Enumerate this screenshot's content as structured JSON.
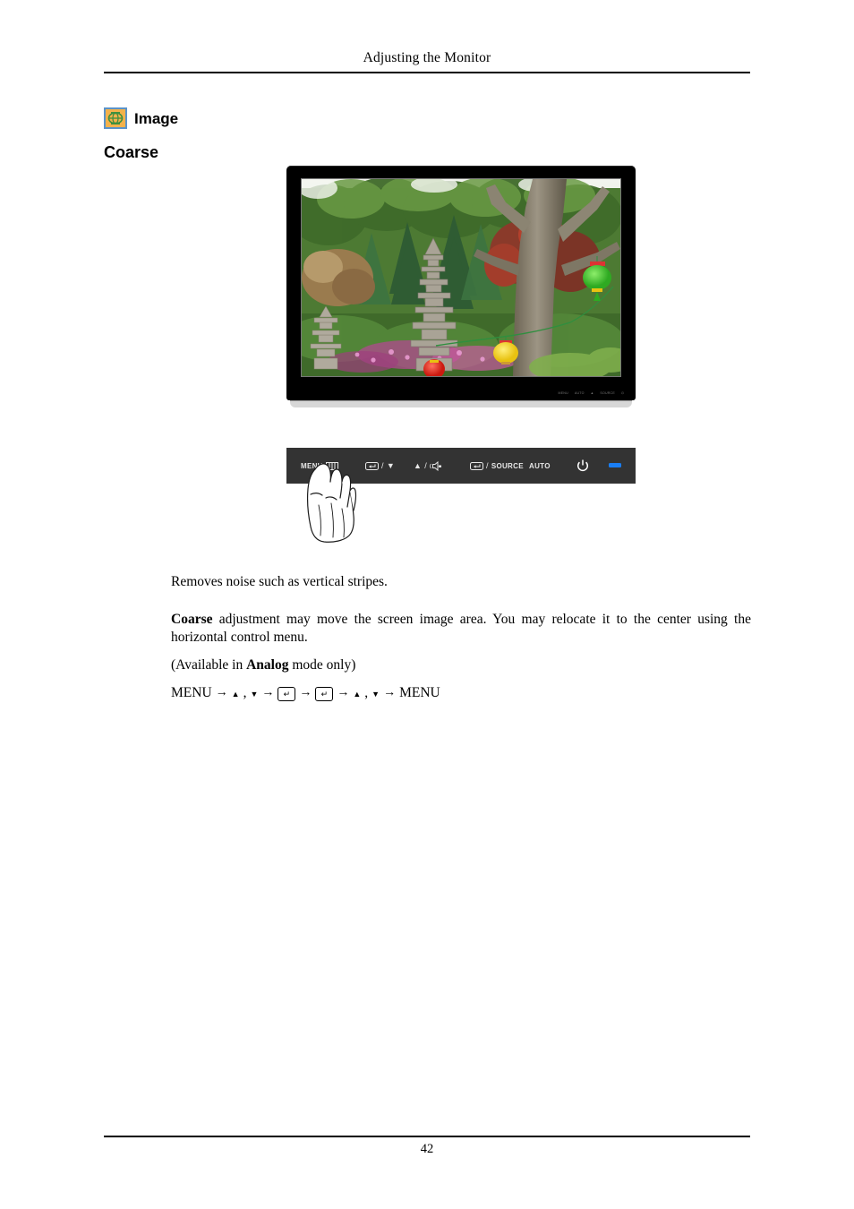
{
  "header": {
    "title": "Adjusting the Monitor"
  },
  "section": {
    "icon_name": "image-settings-icon",
    "title": "Image",
    "subheading": "Coarse",
    "icon_colors": {
      "border": "#5b93c9",
      "fill": "#f3b24b",
      "glyph": "#3f8f3f"
    }
  },
  "monitor": {
    "screen_caption": "Garden scene with stone pagoda, trees and paper lanterns",
    "bezel_labels": [
      "MENU",
      "AUTO",
      "▲",
      "SOURCE",
      "⏻",
      ""
    ]
  },
  "control_panel": {
    "background": "#333333",
    "led_color": "#1a7ef5",
    "buttons": [
      {
        "name": "menu-button",
        "label": "MENU",
        "glyph": "menu-bars-icon"
      },
      {
        "name": "enter-down-button",
        "label": "",
        "glyph": "enter-icon",
        "separator": "/",
        "second_glyph": "▼"
      },
      {
        "name": "up-volume-button",
        "label": "",
        "glyph": "▲",
        "separator": "/",
        "second_glyph": "speaker-icon"
      },
      {
        "name": "source-button",
        "label": "SOURCE",
        "glyph": "enter-icon",
        "separator": "/"
      },
      {
        "name": "auto-button",
        "label": "AUTO",
        "glyph": ""
      },
      {
        "name": "power-button",
        "label": "",
        "glyph": "power-icon"
      },
      {
        "name": "power-led",
        "label": "",
        "glyph": "led-indicator"
      }
    ]
  },
  "hand": {
    "name": "hand-pressing-menu-illustration"
  },
  "body": {
    "paragraph1": "Removes noise such as vertical stripes.",
    "paragraph2_bold": "Coarse",
    "paragraph2_rest": " adjustment may move the screen image area. You may relocate it to the center using the horizontal control menu.",
    "paragraph3_pre": "(Available in ",
    "paragraph3_bold": "Analog",
    "paragraph3_post": " mode only)"
  },
  "nav_path": {
    "start": "MENU",
    "arrow": "→",
    "up": "▲",
    "comma": ",",
    "down": "▼",
    "enter": "↵",
    "end": "MENU"
  },
  "footer": {
    "page_number": "42"
  }
}
